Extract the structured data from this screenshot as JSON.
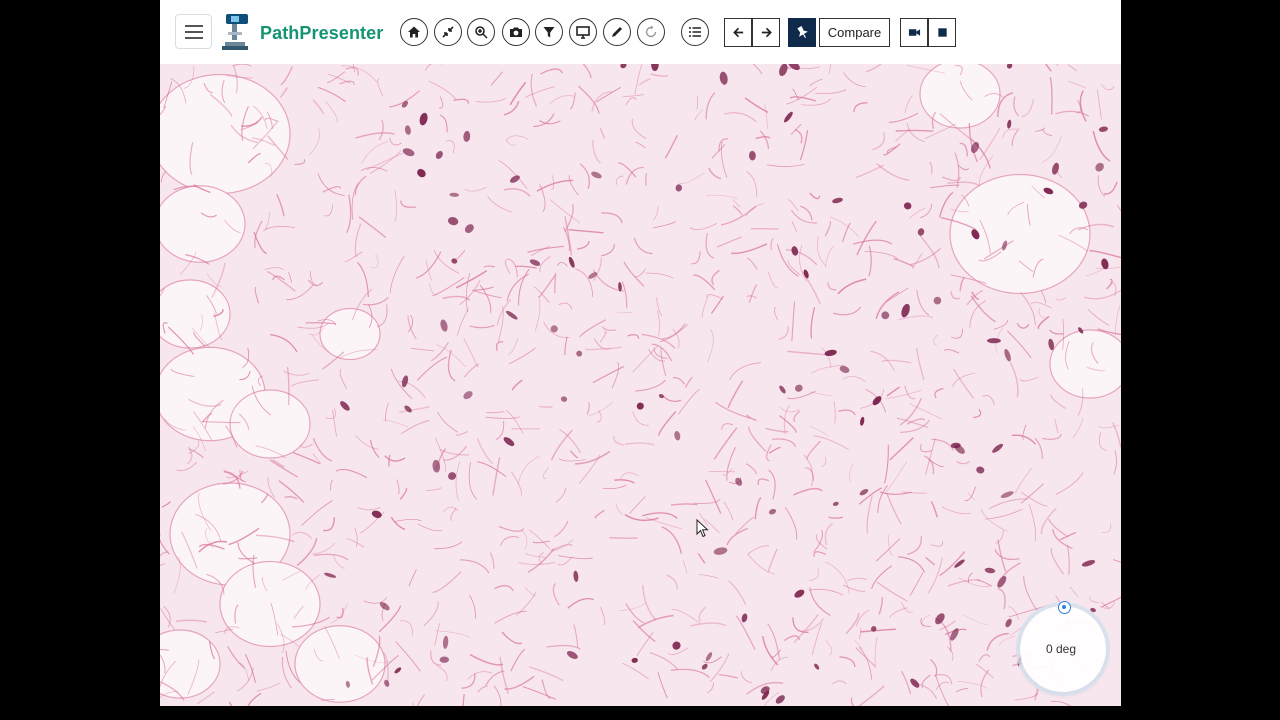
{
  "app": {
    "brand": "PathPresenter"
  },
  "toolbar": {
    "menu_icon": "hamburger-menu-icon",
    "logo_icon": "microscope-logo-icon",
    "tools": [
      {
        "name": "home-icon"
      },
      {
        "name": "fit-to-screen-icon"
      },
      {
        "name": "zoom-icon"
      },
      {
        "name": "camera-icon"
      },
      {
        "name": "filter-icon"
      },
      {
        "name": "monitor-icon"
      },
      {
        "name": "pencil-icon"
      },
      {
        "name": "rotate-icon"
      },
      {
        "name": "list-icon"
      }
    ],
    "nav": [
      {
        "name": "arrow-left-icon"
      },
      {
        "name": "arrow-right-icon"
      }
    ],
    "pin_icon": "pin-icon",
    "compare_label": "Compare",
    "record_icons": [
      "video-camera-icon",
      "stop-icon"
    ]
  },
  "viewer": {
    "stain_colors": {
      "background": "#f7e6ee",
      "fiber": "#d9739a",
      "nucleus": "#7a1f4a",
      "fat": "#fcf5f8"
    },
    "rotation": {
      "label": "0 deg",
      "degrees": 0
    }
  }
}
